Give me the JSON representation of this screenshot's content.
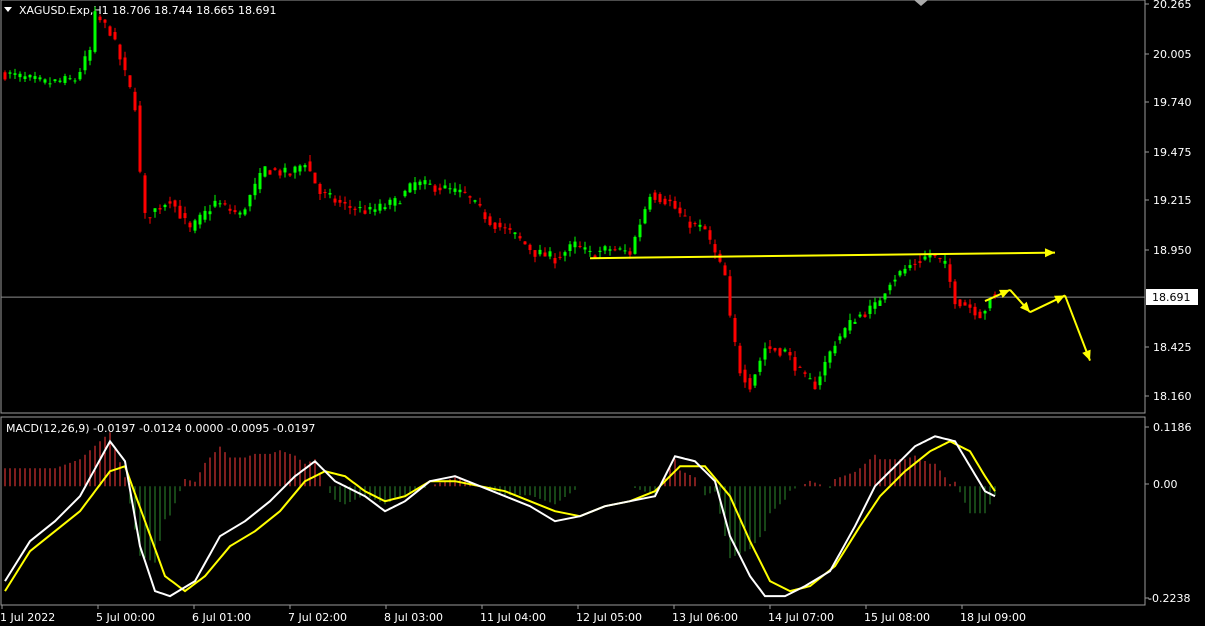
{
  "main_panel": {
    "symbol_info": "XAGUSD.Exp,H1  18.706 18.744 18.665 18.691",
    "current_price_label": "18.691",
    "price_ticks": [
      "20.265",
      "20.005",
      "19.740",
      "19.475",
      "19.215",
      "18.950",
      "18.691",
      "18.425",
      "18.160"
    ]
  },
  "macd_panel": {
    "label": "MACD(12,26,9) -0.0197 -0.0124 0.0000 -0.0095 -0.0197",
    "ticks": [
      "0.1186",
      "0.00",
      "-0.2238"
    ]
  },
  "time_labels": [
    "1 Jul 2022",
    "5 Jul 00:00",
    "6 Jul 01:00",
    "7 Jul 02:00",
    "8 Jul 03:00",
    "11 Jul 04:00",
    "12 Jul 05:00",
    "13 Jul 06:00",
    "14 Jul 07:00",
    "15 Jul 08:00",
    "18 Jul 09:00"
  ],
  "colors": {
    "background": "#000000",
    "bull": "#00ff00",
    "bear": "#ff0000",
    "macd_line": "#ffffff",
    "signal_line": "#ffff00",
    "annotation": "#ffff00",
    "hist_pos": "#ff3c3c",
    "hist_neg": "#2e8b2e",
    "grid": "#808080"
  },
  "chart_data": [
    {
      "type": "candlestick",
      "symbol": "XAGUSD.Exp",
      "timeframe": "H1",
      "ylim": [
        18.1,
        20.28
      ],
      "ohlc_last": {
        "open": 18.706,
        "high": 18.744,
        "low": 18.665,
        "close": 18.691
      },
      "horizontal_line": 18.691,
      "series_path": [
        {
          "t": 0,
          "p": 19.89
        },
        {
          "t": 8,
          "p": 19.84
        },
        {
          "t": 14,
          "p": 19.86
        },
        {
          "t": 17,
          "p": 20.01
        },
        {
          "t": 18,
          "p": 20.2
        },
        {
          "t": 21,
          "p": 20.12
        },
        {
          "t": 23,
          "p": 19.97
        },
        {
          "t": 26,
          "p": 19.72
        },
        {
          "t": 27,
          "p": 19.35
        },
        {
          "t": 28,
          "p": 19.12
        },
        {
          "t": 33,
          "p": 19.22
        },
        {
          "t": 37,
          "p": 19.05
        },
        {
          "t": 42,
          "p": 19.2
        },
        {
          "t": 47,
          "p": 19.13
        },
        {
          "t": 52,
          "p": 19.38
        },
        {
          "t": 57,
          "p": 19.35
        },
        {
          "t": 60,
          "p": 19.42
        },
        {
          "t": 63,
          "p": 19.25
        },
        {
          "t": 68,
          "p": 19.18
        },
        {
          "t": 73,
          "p": 19.15
        },
        {
          "t": 78,
          "p": 19.2
        },
        {
          "t": 82,
          "p": 19.3
        },
        {
          "t": 87,
          "p": 19.28
        },
        {
          "t": 92,
          "p": 19.24
        },
        {
          "t": 97,
          "p": 19.1
        },
        {
          "t": 102,
          "p": 19.02
        },
        {
          "t": 106,
          "p": 18.93
        },
        {
          "t": 110,
          "p": 18.9
        },
        {
          "t": 114,
          "p": 18.97
        },
        {
          "t": 117,
          "p": 18.92
        },
        {
          "t": 121,
          "p": 18.95
        },
        {
          "t": 125,
          "p": 18.93
        },
        {
          "t": 129,
          "p": 19.25
        },
        {
          "t": 133,
          "p": 19.2
        },
        {
          "t": 136,
          "p": 19.1
        },
        {
          "t": 140,
          "p": 19.05
        },
        {
          "t": 142,
          "p": 18.92
        },
        {
          "t": 144,
          "p": 18.8
        },
        {
          "t": 145,
          "p": 18.57
        },
        {
          "t": 147,
          "p": 18.3
        },
        {
          "t": 149,
          "p": 18.22
        },
        {
          "t": 152,
          "p": 18.42
        },
        {
          "t": 156,
          "p": 18.4
        },
        {
          "t": 160,
          "p": 18.25
        },
        {
          "t": 162,
          "p": 18.22
        },
        {
          "t": 166,
          "p": 18.45
        },
        {
          "t": 170,
          "p": 18.58
        },
        {
          "t": 174,
          "p": 18.64
        },
        {
          "t": 177,
          "p": 18.78
        },
        {
          "t": 181,
          "p": 18.86
        },
        {
          "t": 185,
          "p": 18.92
        },
        {
          "t": 188,
          "p": 18.86
        },
        {
          "t": 190,
          "p": 18.68
        },
        {
          "t": 193,
          "p": 18.64
        },
        {
          "t": 195,
          "p": 18.6
        },
        {
          "t": 198,
          "p": 18.69
        }
      ],
      "annotations": [
        {
          "type": "horizontal_arrow",
          "from": {
            "t": 117,
            "p": 18.9
          },
          "to": {
            "t": 210,
            "p": 18.93
          }
        },
        {
          "type": "zigzag_projection",
          "points": [
            {
              "t": 196,
              "p": 18.67
            },
            {
              "t": 201,
              "p": 18.73
            },
            {
              "t": 205,
              "p": 18.61
            },
            {
              "t": 212,
              "p": 18.7
            },
            {
              "t": 217,
              "p": 18.35
            }
          ]
        }
      ]
    },
    {
      "type": "macd",
      "params": [
        12,
        26,
        9
      ],
      "ylim": [
        -0.2238,
        0.1186
      ],
      "values": {
        "macd": -0.0197,
        "signal": -0.0124,
        "histogram": -0.0095
      },
      "macd_path": [
        {
          "t": 0,
          "p": -0.19
        },
        {
          "t": 5,
          "p": -0.11
        },
        {
          "t": 10,
          "p": -0.07
        },
        {
          "t": 15,
          "p": -0.02
        },
        {
          "t": 21,
          "p": 0.09
        },
        {
          "t": 24,
          "p": 0.05
        },
        {
          "t": 27,
          "p": -0.12
        },
        {
          "t": 30,
          "p": -0.21
        },
        {
          "t": 33,
          "p": -0.22
        },
        {
          "t": 38,
          "p": -0.19
        },
        {
          "t": 43,
          "p": -0.1
        },
        {
          "t": 48,
          "p": -0.07
        },
        {
          "t": 53,
          "p": -0.03
        },
        {
          "t": 58,
          "p": 0.02
        },
        {
          "t": 62,
          "p": 0.05
        },
        {
          "t": 66,
          "p": 0.01
        },
        {
          "t": 72,
          "p": -0.02
        },
        {
          "t": 76,
          "p": -0.05
        },
        {
          "t": 80,
          "p": -0.03
        },
        {
          "t": 85,
          "p": 0.01
        },
        {
          "t": 90,
          "p": 0.02
        },
        {
          "t": 95,
          "p": 0.0
        },
        {
          "t": 100,
          "p": -0.02
        },
        {
          "t": 105,
          "p": -0.04
        },
        {
          "t": 110,
          "p": -0.07
        },
        {
          "t": 115,
          "p": -0.06
        },
        {
          "t": 120,
          "p": -0.04
        },
        {
          "t": 125,
          "p": -0.03
        },
        {
          "t": 130,
          "p": -0.02
        },
        {
          "t": 134,
          "p": 0.06
        },
        {
          "t": 138,
          "p": 0.05
        },
        {
          "t": 142,
          "p": 0.01
        },
        {
          "t": 145,
          "p": -0.1
        },
        {
          "t": 149,
          "p": -0.18
        },
        {
          "t": 152,
          "p": -0.22
        },
        {
          "t": 156,
          "p": -0.22
        },
        {
          "t": 160,
          "p": -0.2
        },
        {
          "t": 165,
          "p": -0.17
        },
        {
          "t": 170,
          "p": -0.08
        },
        {
          "t": 174,
          "p": 0.0
        },
        {
          "t": 178,
          "p": 0.04
        },
        {
          "t": 182,
          "p": 0.08
        },
        {
          "t": 186,
          "p": 0.1
        },
        {
          "t": 190,
          "p": 0.09
        },
        {
          "t": 193,
          "p": 0.04
        },
        {
          "t": 196,
          "p": -0.01
        },
        {
          "t": 198,
          "p": -0.02
        }
      ],
      "signal_path": [
        {
          "t": 0,
          "p": -0.21
        },
        {
          "t": 5,
          "p": -0.13
        },
        {
          "t": 10,
          "p": -0.09
        },
        {
          "t": 15,
          "p": -0.05
        },
        {
          "t": 21,
          "p": 0.03
        },
        {
          "t": 24,
          "p": 0.04
        },
        {
          "t": 28,
          "p": -0.07
        },
        {
          "t": 32,
          "p": -0.18
        },
        {
          "t": 36,
          "p": -0.21
        },
        {
          "t": 40,
          "p": -0.18
        },
        {
          "t": 45,
          "p": -0.12
        },
        {
          "t": 50,
          "p": -0.09
        },
        {
          "t": 55,
          "p": -0.05
        },
        {
          "t": 60,
          "p": 0.01
        },
        {
          "t": 64,
          "p": 0.03
        },
        {
          "t": 68,
          "p": 0.02
        },
        {
          "t": 72,
          "p": -0.01
        },
        {
          "t": 76,
          "p": -0.03
        },
        {
          "t": 80,
          "p": -0.02
        },
        {
          "t": 85,
          "p": 0.01
        },
        {
          "t": 90,
          "p": 0.01
        },
        {
          "t": 95,
          "p": 0.0
        },
        {
          "t": 100,
          "p": -0.01
        },
        {
          "t": 105,
          "p": -0.03
        },
        {
          "t": 110,
          "p": -0.05
        },
        {
          "t": 115,
          "p": -0.06
        },
        {
          "t": 120,
          "p": -0.04
        },
        {
          "t": 125,
          "p": -0.03
        },
        {
          "t": 130,
          "p": -0.01
        },
        {
          "t": 135,
          "p": 0.04
        },
        {
          "t": 140,
          "p": 0.04
        },
        {
          "t": 145,
          "p": -0.02
        },
        {
          "t": 149,
          "p": -0.11
        },
        {
          "t": 153,
          "p": -0.19
        },
        {
          "t": 157,
          "p": -0.21
        },
        {
          "t": 161,
          "p": -0.2
        },
        {
          "t": 166,
          "p": -0.16
        },
        {
          "t": 171,
          "p": -0.08
        },
        {
          "t": 175,
          "p": -0.02
        },
        {
          "t": 180,
          "p": 0.03
        },
        {
          "t": 185,
          "p": 0.07
        },
        {
          "t": 189,
          "p": 0.09
        },
        {
          "t": 193,
          "p": 0.07
        },
        {
          "t": 196,
          "p": 0.02
        },
        {
          "t": 198,
          "p": -0.01
        }
      ]
    }
  ]
}
